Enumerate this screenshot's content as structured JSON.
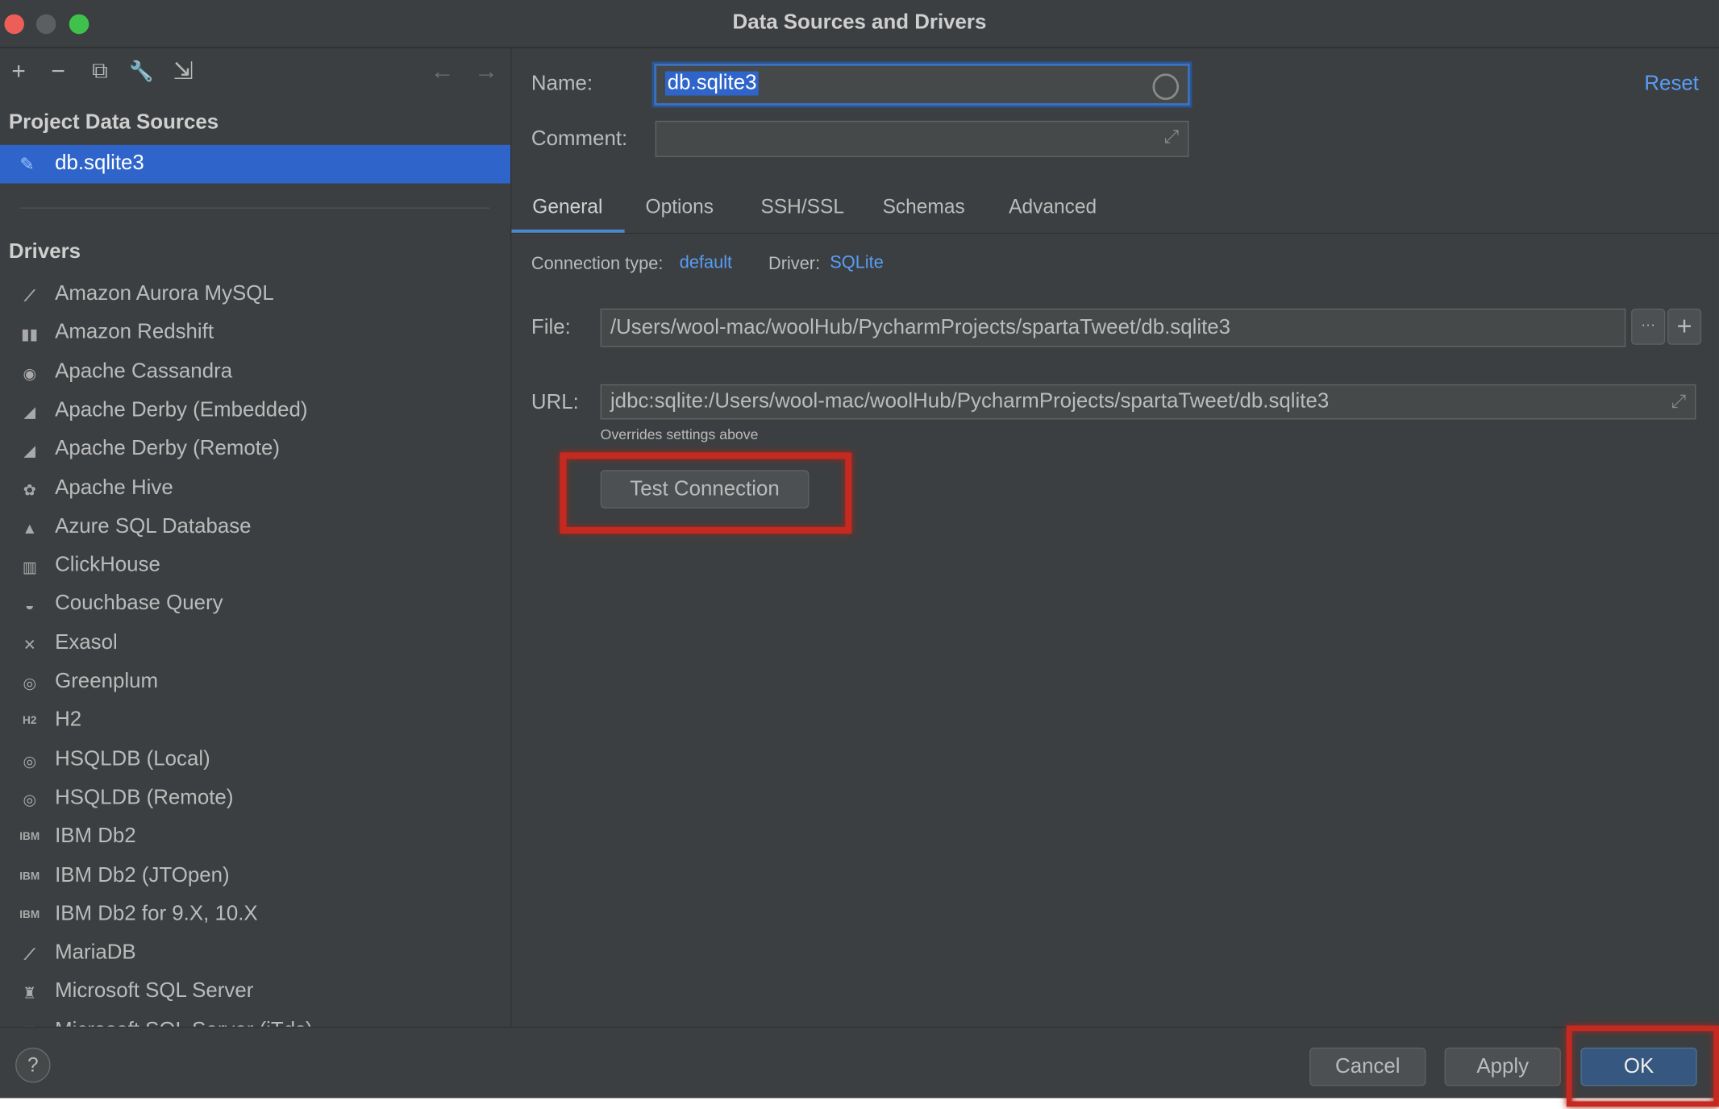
{
  "window": {
    "title": "Data Sources and Drivers"
  },
  "toolbar": {
    "add": "+",
    "remove": "−",
    "copy": "⧉",
    "settings": "🔧",
    "import": "⇲",
    "back": "←",
    "forward": "→"
  },
  "left": {
    "project_heading": "Project Data Sources",
    "selected_source": "db.sqlite3",
    "drivers_heading": "Drivers",
    "drivers": [
      {
        "label": "Amazon Aurora MySQL",
        "icon": "⟋"
      },
      {
        "label": "Amazon Redshift",
        "icon": "▮▮"
      },
      {
        "label": "Apache Cassandra",
        "icon": "◉"
      },
      {
        "label": "Apache Derby (Embedded)",
        "icon": "◢"
      },
      {
        "label": "Apache Derby (Remote)",
        "icon": "◢"
      },
      {
        "label": "Apache Hive",
        "icon": "✿"
      },
      {
        "label": "Azure SQL Database",
        "icon": "▲"
      },
      {
        "label": "ClickHouse",
        "icon": "▥"
      },
      {
        "label": "Couchbase Query",
        "icon": "◒"
      },
      {
        "label": "Exasol",
        "icon": "✕"
      },
      {
        "label": "Greenplum",
        "icon": "◎"
      },
      {
        "label": "H2",
        "icon": "H2"
      },
      {
        "label": "HSQLDB (Local)",
        "icon": "◎"
      },
      {
        "label": "HSQLDB (Remote)",
        "icon": "◎"
      },
      {
        "label": "IBM Db2",
        "icon": "IBM"
      },
      {
        "label": "IBM Db2 (JTOpen)",
        "icon": "IBM"
      },
      {
        "label": "IBM Db2 for 9.X, 10.X",
        "icon": "IBM"
      },
      {
        "label": "MariaDB",
        "icon": "⟋"
      },
      {
        "label": "Microsoft SQL Server",
        "icon": "♜"
      },
      {
        "label": "Microsoft SQL Server (jTds)",
        "icon": "♜"
      }
    ]
  },
  "form": {
    "name_label": "Name:",
    "name_value": "db.sqlite3",
    "reset": "Reset",
    "comment_label": "Comment:",
    "comment_value": "",
    "tabs": [
      "General",
      "Options",
      "SSH/SSL",
      "Schemas",
      "Advanced"
    ],
    "connection_type_label": "Connection type:",
    "connection_type_value": "default",
    "driver_label": "Driver:",
    "driver_value": "SQLite",
    "file_label": "File:",
    "file_value": "/Users/wool-mac/woolHub/PycharmProjects/spartaTweet/db.sqlite3",
    "file_browse": "···",
    "file_add": "+",
    "url_label": "URL:",
    "url_value": "jdbc:sqlite:/Users/wool-mac/woolHub/PycharmProjects/spartaTweet/db.sqlite3",
    "url_hint": "Overrides settings above",
    "test_connection": "Test Connection"
  },
  "footer": {
    "help": "?",
    "cancel": "Cancel",
    "apply": "Apply",
    "ok": "OK"
  },
  "colors": {
    "selection": "#2f65ca",
    "link": "#589df6",
    "annotation": "#c42a20"
  }
}
